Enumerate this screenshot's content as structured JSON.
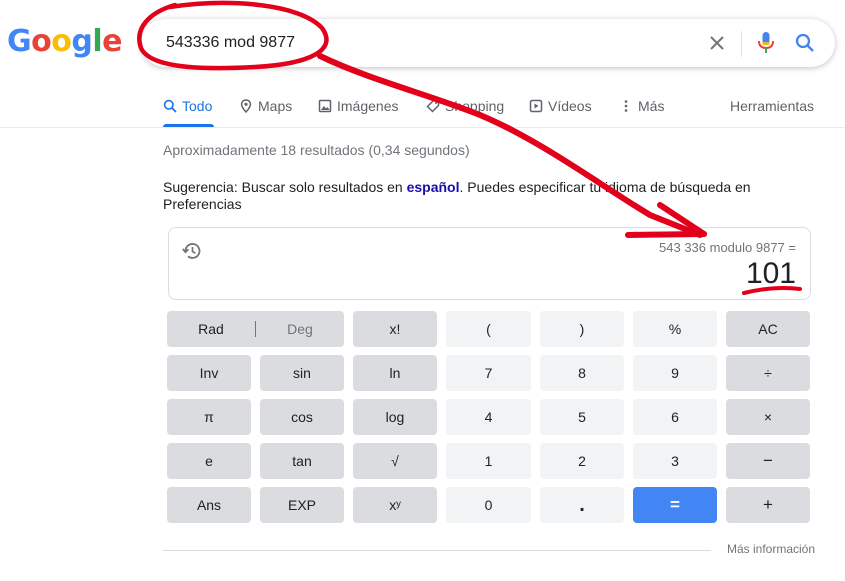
{
  "logo": {
    "text": "Google"
  },
  "search": {
    "query": "543336 mod 9877"
  },
  "tabs": [
    {
      "label": "Todo"
    },
    {
      "label": "Maps"
    },
    {
      "label": "Imágenes"
    },
    {
      "label": "Shopping"
    },
    {
      "label": "Vídeos"
    },
    {
      "label": "Más"
    }
  ],
  "tools_label": "Herramientas",
  "result_stats": "Aproximadamente 18 resultados (0,34 segundos)",
  "suggestion": {
    "prefix": "Sugerencia: Buscar solo resultados en ",
    "link": "español",
    "suffix": ". Puedes especificar tu idioma de búsqueda en ",
    "settings_link": "Preferencias"
  },
  "calculator": {
    "expression": "543 336 modulo 9877 =",
    "result": "101",
    "rad_label": "Rad",
    "deg_label": "Deg",
    "rows": [
      [
        "x!",
        "(",
        ")",
        "%",
        "AC"
      ],
      [
        "Inv",
        "sin",
        "ln",
        "7",
        "8",
        "9",
        "÷"
      ],
      [
        "π",
        "cos",
        "log",
        "4",
        "5",
        "6",
        "×"
      ],
      [
        "e",
        "tan",
        "√",
        "1",
        "2",
        "3",
        "−"
      ],
      [
        "Ans",
        "EXP",
        "xʸ",
        "0",
        ".",
        "=",
        "+"
      ]
    ]
  },
  "more_info": "Más información",
  "colors": {
    "accent": "#1a73e8",
    "annotation": "#e3001b",
    "equals_button": "#4285f4"
  }
}
